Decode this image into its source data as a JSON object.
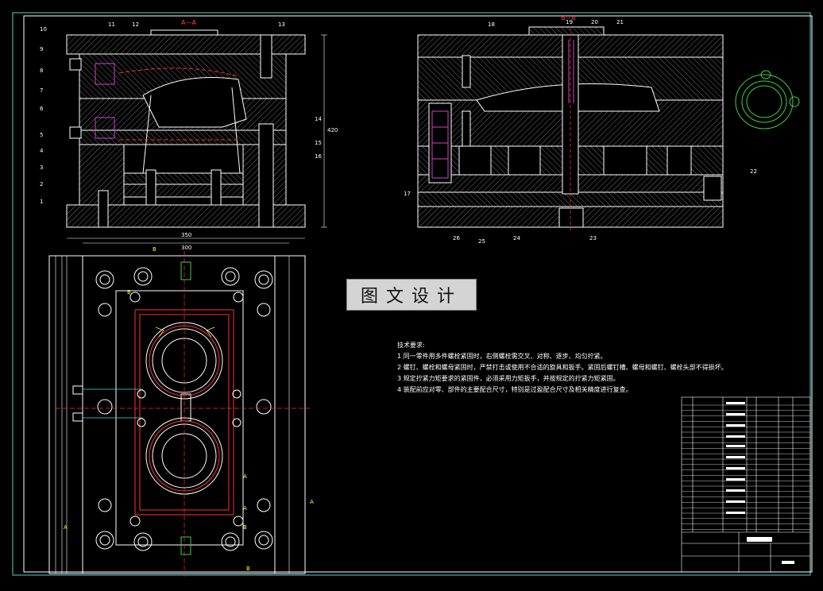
{
  "drawing": {
    "section_label_left": "A—A",
    "section_label_right": "B—B",
    "watermark": "图文设计",
    "tech_title": "技术要求:",
    "tech_notes": [
      "1 同一零件用多件螺栓紧固时，右侧螺栓需交叉、对称、逐步、均匀拧紧。",
      "2 螺钉、螺栓和螺母紧固时，严禁打击或使用不合适的旋具和扳手。紧固后螺钉槽、螺母和螺钉、螺栓头部不得损坏。",
      "3 规定拧紧力矩要求的紧固件，必须采用力矩扳手，并按规定的拧紧力矩紧固。",
      "4 装配前应对零、部件的主要配合尺寸，特别是过盈配合尺寸及相关精度进行复查。"
    ],
    "part_numbers_left": [
      "10",
      "9",
      "8",
      "7",
      "6",
      "5",
      "4",
      "3",
      "2",
      "1"
    ],
    "part_numbers_top": [
      "11",
      "12",
      "13"
    ],
    "part_numbers_right_of_left_view": [
      "14",
      "15",
      "16"
    ],
    "part_numbers_right_view_top": [
      "18",
      "19",
      "20",
      "21"
    ],
    "part_numbers_right_view_bottom": [
      "17",
      "26",
      "25",
      "24",
      "23",
      "22"
    ],
    "dimension_labels": {
      "overall_width": "350",
      "inner_width": "300",
      "height_side": "420"
    },
    "section_markers": [
      "B",
      "B",
      "A",
      "A",
      "A",
      "A",
      "B",
      "B"
    ]
  },
  "colors": {
    "background": "#000000",
    "frame": "#ffffff",
    "outline": "#ffffff",
    "hatch": "#9a9a9a",
    "cavity": "#ff3030",
    "centerline": "#ff3030",
    "dimension": "#ffffff",
    "waterline": "#d040d0",
    "iso_view": "#40d040",
    "ejector": "#40e0e0",
    "yellow": "#ffff40"
  }
}
